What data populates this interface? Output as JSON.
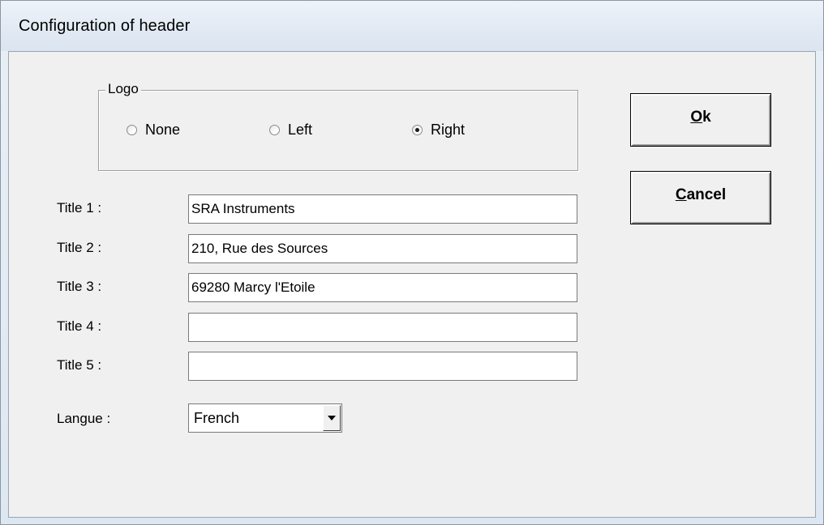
{
  "window": {
    "title": "Configuration of header"
  },
  "logo": {
    "group_label": "Logo",
    "options": [
      {
        "label": "None",
        "checked": false
      },
      {
        "label": "Left",
        "checked": false
      },
      {
        "label": "Right",
        "checked": true
      }
    ]
  },
  "titles": [
    {
      "label": "Title 1 :",
      "value": "SRA Instruments"
    },
    {
      "label": "Title 2 :",
      "value": "210, Rue des Sources"
    },
    {
      "label": "Title 3 :",
      "value": "69280 Marcy l'Etoile"
    },
    {
      "label": "Title 4 :",
      "value": ""
    },
    {
      "label": "Title 5 :",
      "value": ""
    }
  ],
  "language": {
    "label": "Langue :",
    "selected": "French"
  },
  "buttons": {
    "ok": {
      "mnemonic": "O",
      "rest": "k"
    },
    "cancel": {
      "mnemonic": "C",
      "rest": "ancel"
    }
  }
}
